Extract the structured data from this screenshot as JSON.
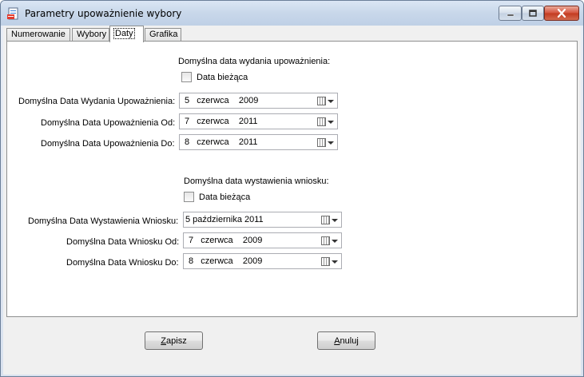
{
  "window": {
    "title": "Parametry upoważnienie wybory"
  },
  "tabs": [
    {
      "label": "Numerowanie"
    },
    {
      "label": "Wybory"
    },
    {
      "label": "Daty"
    },
    {
      "label": "Grafika"
    }
  ],
  "section1": {
    "header": "Domyślna data wydania upoważnienia:",
    "checkbox_label": "Data bieżąca",
    "checkbox_checked": false,
    "fields": [
      {
        "label": "Domyślna Data Wydania Upoważnienia:",
        "value": "5   czerwca    2009"
      },
      {
        "label": "Domyślna Data Upoważnienia Od:",
        "value": "7   czerwca    2011"
      },
      {
        "label": "Domyślna Data Upoważnienia Do:",
        "value": "8   czerwca    2011"
      }
    ]
  },
  "section2": {
    "header": "Domyślna data wystawienia wniosku:",
    "checkbox_label": "Data bieżąca",
    "checkbox_checked": false,
    "fields": [
      {
        "label": "Domyślna Data Wystawienia Wniosku:",
        "value": "5 października 2011"
      },
      {
        "label": "Domyślna Data Wniosku Od:",
        "value": "7   czerwca    2009"
      },
      {
        "label": "Domyślna Data Wniosku Do:",
        "value": "8   czerwca    2009"
      }
    ]
  },
  "buttons": {
    "save": {
      "label": "Zapisz",
      "accesskey": "Z"
    },
    "cancel": {
      "label": "Anuluj",
      "accesskey": "A"
    }
  },
  "icons": {
    "app": "document-app-icon",
    "minimize": "minimize-icon",
    "maximize": "maximize-icon",
    "close": "close-icon",
    "calendar": "calendar-icon"
  }
}
